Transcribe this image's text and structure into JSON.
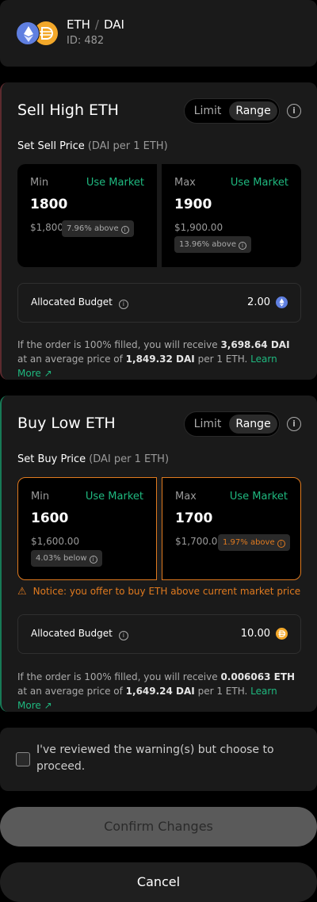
{
  "header": {
    "base": "ETH",
    "separator": "/",
    "quote": "DAI",
    "id_label": "ID: 482"
  },
  "sell": {
    "title": "Sell High ETH",
    "tab_limit": "Limit",
    "tab_range": "Range",
    "set_price_label": "Set Sell Price",
    "unit_label": "(DAI per 1 ETH)",
    "min": {
      "label": "Min",
      "use_market": "Use Market",
      "value": "1800",
      "fiat": "$1,800.00",
      "badge": "7.96% above"
    },
    "max": {
      "label": "Max",
      "use_market": "Use Market",
      "value": "1900",
      "fiat": "$1,900.00",
      "badge": "13.96% above"
    },
    "budget_label": "Allocated Budget",
    "budget_value": "2.00",
    "note_prefix": "If the order is 100% filled, you will receive ",
    "note_amount": "3,698.64 DAI",
    "note_mid": " at an average price of ",
    "note_price": "1,849.32 DAI",
    "note_suffix": " per 1 ETH. ",
    "learn_more": "Learn More"
  },
  "buy": {
    "title": "Buy Low ETH",
    "tab_limit": "Limit",
    "tab_range": "Range",
    "set_price_label": "Set Buy Price",
    "unit_label": "(DAI per 1 ETH)",
    "min": {
      "label": "Min",
      "use_market": "Use Market",
      "value": "1600",
      "fiat": "$1,600.00",
      "badge": "4.03% below"
    },
    "max": {
      "label": "Max",
      "use_market": "Use Market",
      "value": "1700",
      "fiat": "$1,700.00",
      "badge": "1.97% above"
    },
    "warning": "Notice: you offer to buy ETH above current market price",
    "budget_label": "Allocated Budget",
    "budget_value": "10.00",
    "note_prefix": "If the order is 100% filled, you will receive ",
    "note_amount": "0.006063 ETH",
    "note_mid": " at an average price of ",
    "note_price": "1,649.24 DAI",
    "note_suffix": " per 1 ETH. ",
    "learn_more": "Learn More"
  },
  "ack": {
    "text": "I've reviewed the warning(s) but choose to proceed."
  },
  "buttons": {
    "confirm": "Confirm Changes",
    "cancel": "Cancel"
  },
  "colors": {
    "accent_green": "#1fb87f",
    "warning_orange": "#e07a1f",
    "eth_blue": "#5f7fe0",
    "dai_yellow": "#f3a82a"
  },
  "icons": [
    "eth-token-icon",
    "dai-token-icon",
    "info-icon",
    "external-link-icon",
    "warning-icon",
    "checkbox"
  ]
}
